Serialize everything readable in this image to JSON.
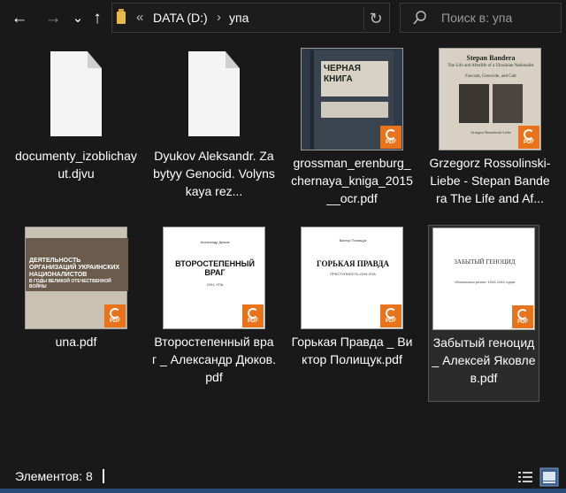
{
  "address": {
    "prefix": "«",
    "drive": "DATA (D:)",
    "chevron": "›",
    "folder": "упа"
  },
  "search": {
    "placeholder": "Поиск в: упа"
  },
  "nav": {
    "back": "←",
    "forward": "→",
    "dropdown": "⌄",
    "up": "↑",
    "refresh": "↻"
  },
  "files": [
    {
      "name": "documenty_izoblichayut.djvu",
      "kind": "doc"
    },
    {
      "name": "Dyukov Aleksandr. Zabytyy Genocid. Volynskaya rez...",
      "kind": "doc"
    },
    {
      "name": "grossman_erenburg_chernaya_kniga_2015__ocr.pdf",
      "kind": "pdf",
      "cover_title": "ЧЕРНАЯ КНИГА"
    },
    {
      "name": "Grzegorz Rossolinski-Liebe - Stepan Bandera The Life and Af...",
      "kind": "pdf",
      "cover_title": "Stepan Bandera",
      "cover_subtitle": "The Life and Afterlife of a Ukrainian Nationalist",
      "cover_sub2": "Fascism, Genocide, and Cult",
      "cover_author": "Grzegorz Rossolinski-Liebe"
    },
    {
      "name": "una.pdf",
      "kind": "pdf",
      "cover_title": "ДЕЯТЕЛЬНОСТЬ ОРГАНИЗАЦИЙ УКРАИНСКИХ НАЦИОНАЛИСТОВ",
      "cover_sub": "В ГОДЫ ВЕЛИКОЙ ОТЕЧЕСТВЕННОЙ ВОЙНЫ"
    },
    {
      "name": "Второстепенный враг _ Александр Дюков.pdf",
      "kind": "pdf",
      "cover_title": "ВТОРОСТЕПЕННЫЙ ВРАГ",
      "cover_author": "Александр Дюков",
      "cover_sub": "ОУН, УПА"
    },
    {
      "name": "Горькая Правда _ Виктор Полищук.pdf",
      "kind": "pdf",
      "cover_title": "ГОРЬКАЯ ПРАВДА",
      "cover_author": "Виктор Полищук",
      "cover_sub": "ПРЕСТУПНОСТЬ ОУН-УПА"
    },
    {
      "name": "Забытый геноцид _ Алексей Яковлев.pdf",
      "kind": "pdf",
      "cover_title": "ЗАБЫТЫЙ ГЕНОЦИД",
      "cover_sub": "«Волынская резня» 1943-1944 годов"
    }
  ],
  "badge_text": "PDF",
  "status": {
    "count": "Элементов: 8"
  }
}
